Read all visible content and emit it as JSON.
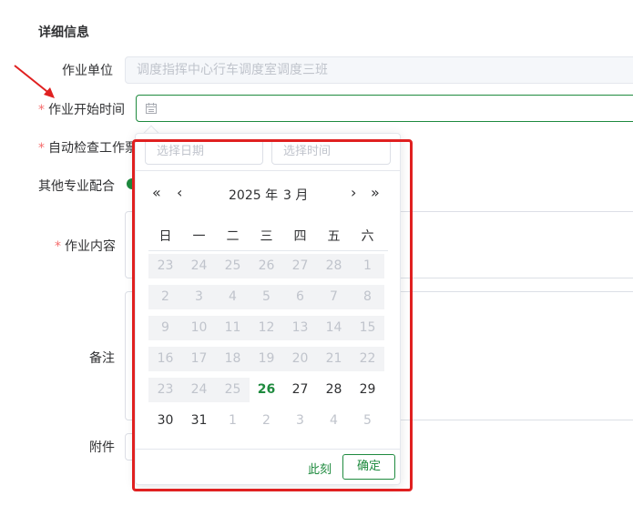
{
  "form": {
    "section_title": "详细信息",
    "unit_label": "作业单位",
    "unit_value": "调度指挥中心行车调度室调度三班",
    "start_time_label": "作业开始时间",
    "auto_check_label": "自动检查工作票",
    "other_coop_label": "其他专业配合",
    "content_label": "作业内容",
    "remark_label": "备注",
    "attachment_label": "附件",
    "required_mark": "*"
  },
  "picker": {
    "date_placeholder": "选择日期",
    "time_placeholder": "选择时间",
    "year": "2025 年",
    "month": "3 月",
    "prev_year": "«",
    "prev_month": "‹",
    "next_month": "›",
    "next_year": "»",
    "weekdays": [
      "日",
      "一",
      "二",
      "三",
      "四",
      "五",
      "六"
    ],
    "weeks": [
      [
        "23",
        "24",
        "25",
        "26",
        "27",
        "28",
        "1"
      ],
      [
        "2",
        "3",
        "4",
        "5",
        "6",
        "7",
        "8"
      ],
      [
        "9",
        "10",
        "11",
        "12",
        "13",
        "14",
        "15"
      ],
      [
        "16",
        "17",
        "18",
        "19",
        "20",
        "21",
        "22"
      ],
      [
        "23",
        "24",
        "25",
        "26",
        "27",
        "28",
        "29"
      ],
      [
        "30",
        "31",
        "1",
        "2",
        "3",
        "4",
        "5"
      ]
    ],
    "today": "26",
    "now_label": "此刻",
    "confirm_label": "确定"
  },
  "colors": {
    "accent": "#1e8a3e",
    "annotation": "#e02020",
    "required": "#f56c6c"
  }
}
